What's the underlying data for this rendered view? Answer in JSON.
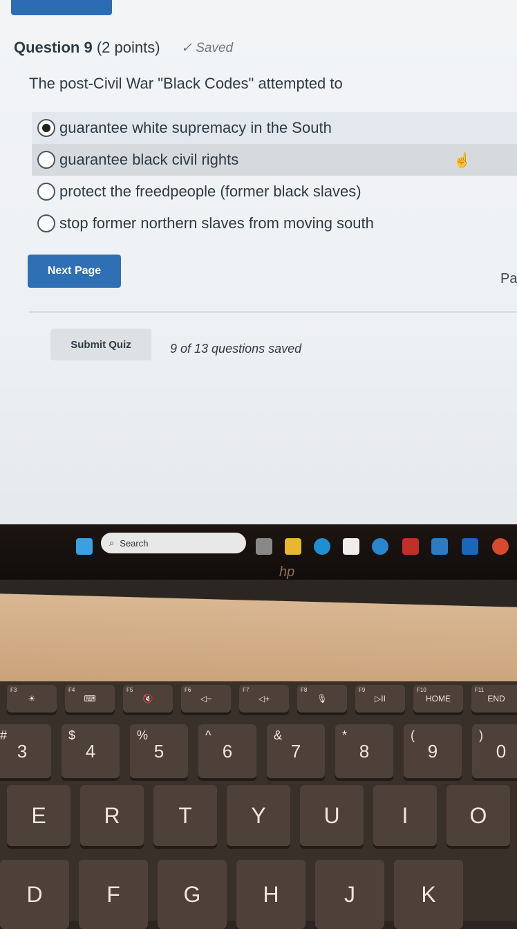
{
  "quiz": {
    "question_label": "Question 9",
    "points": "(2 points)",
    "saved_icon": "checkmark-icon",
    "saved_label": "Saved",
    "question_text": "The post-Civil War \"Black Codes\" attempted to",
    "options": [
      {
        "label": "guarantee white supremacy in the South",
        "selected": true
      },
      {
        "label": "guarantee black civil rights",
        "selected": false
      },
      {
        "label": "protect the freedpeople (former black slaves)",
        "selected": false
      },
      {
        "label": "stop former northern slaves from moving south",
        "selected": false
      }
    ],
    "next_page_label": "Next Page",
    "side_text": "Pa",
    "submit_label": "Submit Quiz",
    "status_text": "9 of 13 questions saved",
    "accent_color": "#2f6fb4"
  },
  "taskbar": {
    "search_placeholder": "Search",
    "icons": [
      "windows-start-icon",
      "search-icon",
      "task-view-icon",
      "file-explorer-icon",
      "edge-icon",
      "store-icon",
      "help-icon",
      "mcafee-icon",
      "myhp-icon",
      "outlook-icon",
      "chrome-icon"
    ]
  },
  "laptop": {
    "brand": "hp"
  },
  "keyboard": {
    "fn_row": [
      {
        "fn": "F3",
        "label": "☀"
      },
      {
        "fn": "F4",
        "label": "⌨"
      },
      {
        "fn": "F5",
        "label": "🔇"
      },
      {
        "fn": "F6",
        "label": "◁−"
      },
      {
        "fn": "F7",
        "label": "◁+"
      },
      {
        "fn": "F8",
        "label": "🎙"
      },
      {
        "fn": "F9",
        "label": "▷II"
      },
      {
        "fn": "F10",
        "label": "HOME"
      },
      {
        "fn": "F11",
        "label": "END"
      }
    ],
    "num_row": [
      {
        "shift": "#",
        "key": "3"
      },
      {
        "shift": "$",
        "key": "4"
      },
      {
        "shift": "%",
        "key": "5"
      },
      {
        "shift": "^",
        "key": "6"
      },
      {
        "shift": "&",
        "key": "7"
      },
      {
        "shift": "*",
        "key": "8"
      },
      {
        "shift": "(",
        "key": "9"
      },
      {
        "shift": ")",
        "key": "0"
      }
    ],
    "letter_row": [
      "E",
      "R",
      "T",
      "Y",
      "U",
      "I",
      "O"
    ],
    "home_row": [
      "D",
      "F",
      "G",
      "H",
      "J",
      "K"
    ]
  }
}
